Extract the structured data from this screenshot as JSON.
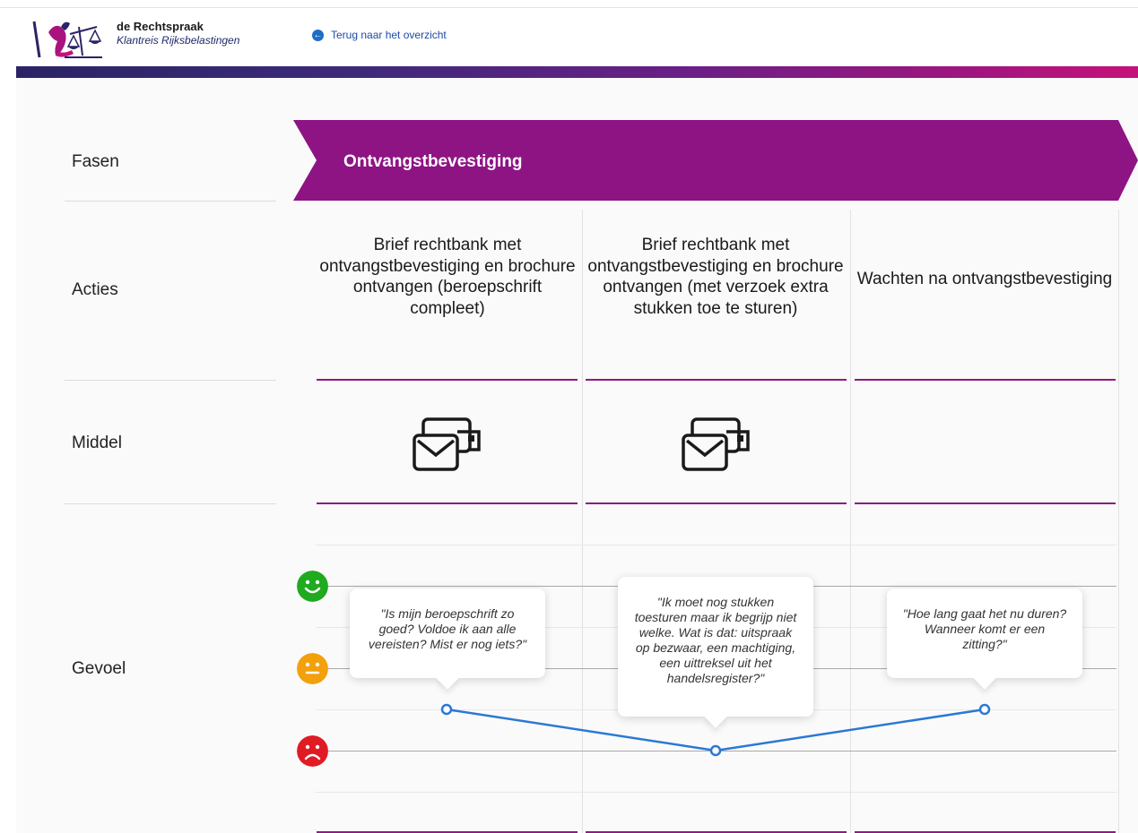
{
  "header": {
    "brand_name": "de Rechtspraak",
    "brand_subtitle": "Klantreis Rijksbelastingen",
    "back_link": "Terug naar het overzicht"
  },
  "rows": {
    "fasen": "Fasen",
    "acties": "Acties",
    "middel": "Middel",
    "gevoel": "Gevoel"
  },
  "phase": {
    "title": "Ontvangstbevestiging",
    "color": "#8e1484"
  },
  "columns": [
    {
      "action": "Brief rechtbank met ontvangstbevestiging en brochure ontvangen (beroepschrift compleet)",
      "middel_icon": "mail-letters-icon",
      "quote": "\"Is mijn beroepschrift zo goed? Voldoe ik aan alle vereisten? Mist er nog iets?\""
    },
    {
      "action": "Brief rechtbank met ontvangstbevestiging en brochure ontvangen (met verzoek extra stukken toe te sturen)",
      "middel_icon": "mail-letters-icon",
      "quote": "\"Ik moet nog stukken toesturen maar ik begrijp niet welke. Wat is dat: uitspraak op bezwaar, een machtiging, een uittreksel uit het handelsregister?\""
    },
    {
      "action": "Wachten na ontvangstbevestiging",
      "middel_icon": "",
      "quote": "\"Hoe lang gaat het nu duren? Wanneer komt er een zitting?\""
    }
  ],
  "feelings": {
    "levels": [
      "positive",
      "neutral",
      "negative"
    ],
    "icons": [
      "happy-face-icon",
      "neutral-face-icon",
      "sad-face-icon"
    ],
    "colors": {
      "positive": "#1faa1f",
      "neutral": "#f2a00c",
      "negative": "#e01b24"
    },
    "line_color": "#2b78d4"
  },
  "chart_data": {
    "type": "line",
    "categories": [
      "Brief rechtbank met ontvangstbevestiging en brochure ontvangen (beroepschrift compleet)",
      "Brief rechtbank met ontvangstbevestiging en brochure ontvangen (met verzoek extra stukken toe te sturen)",
      "Wachten na ontvangstbevestiging"
    ],
    "ylabel": "Gevoel",
    "yscale": "positive (top) to negative (bottom)",
    "series": [
      {
        "values": [
          -0.5,
          -1.0,
          -0.5
        ]
      }
    ],
    "ylim": [
      -1,
      1
    ]
  }
}
